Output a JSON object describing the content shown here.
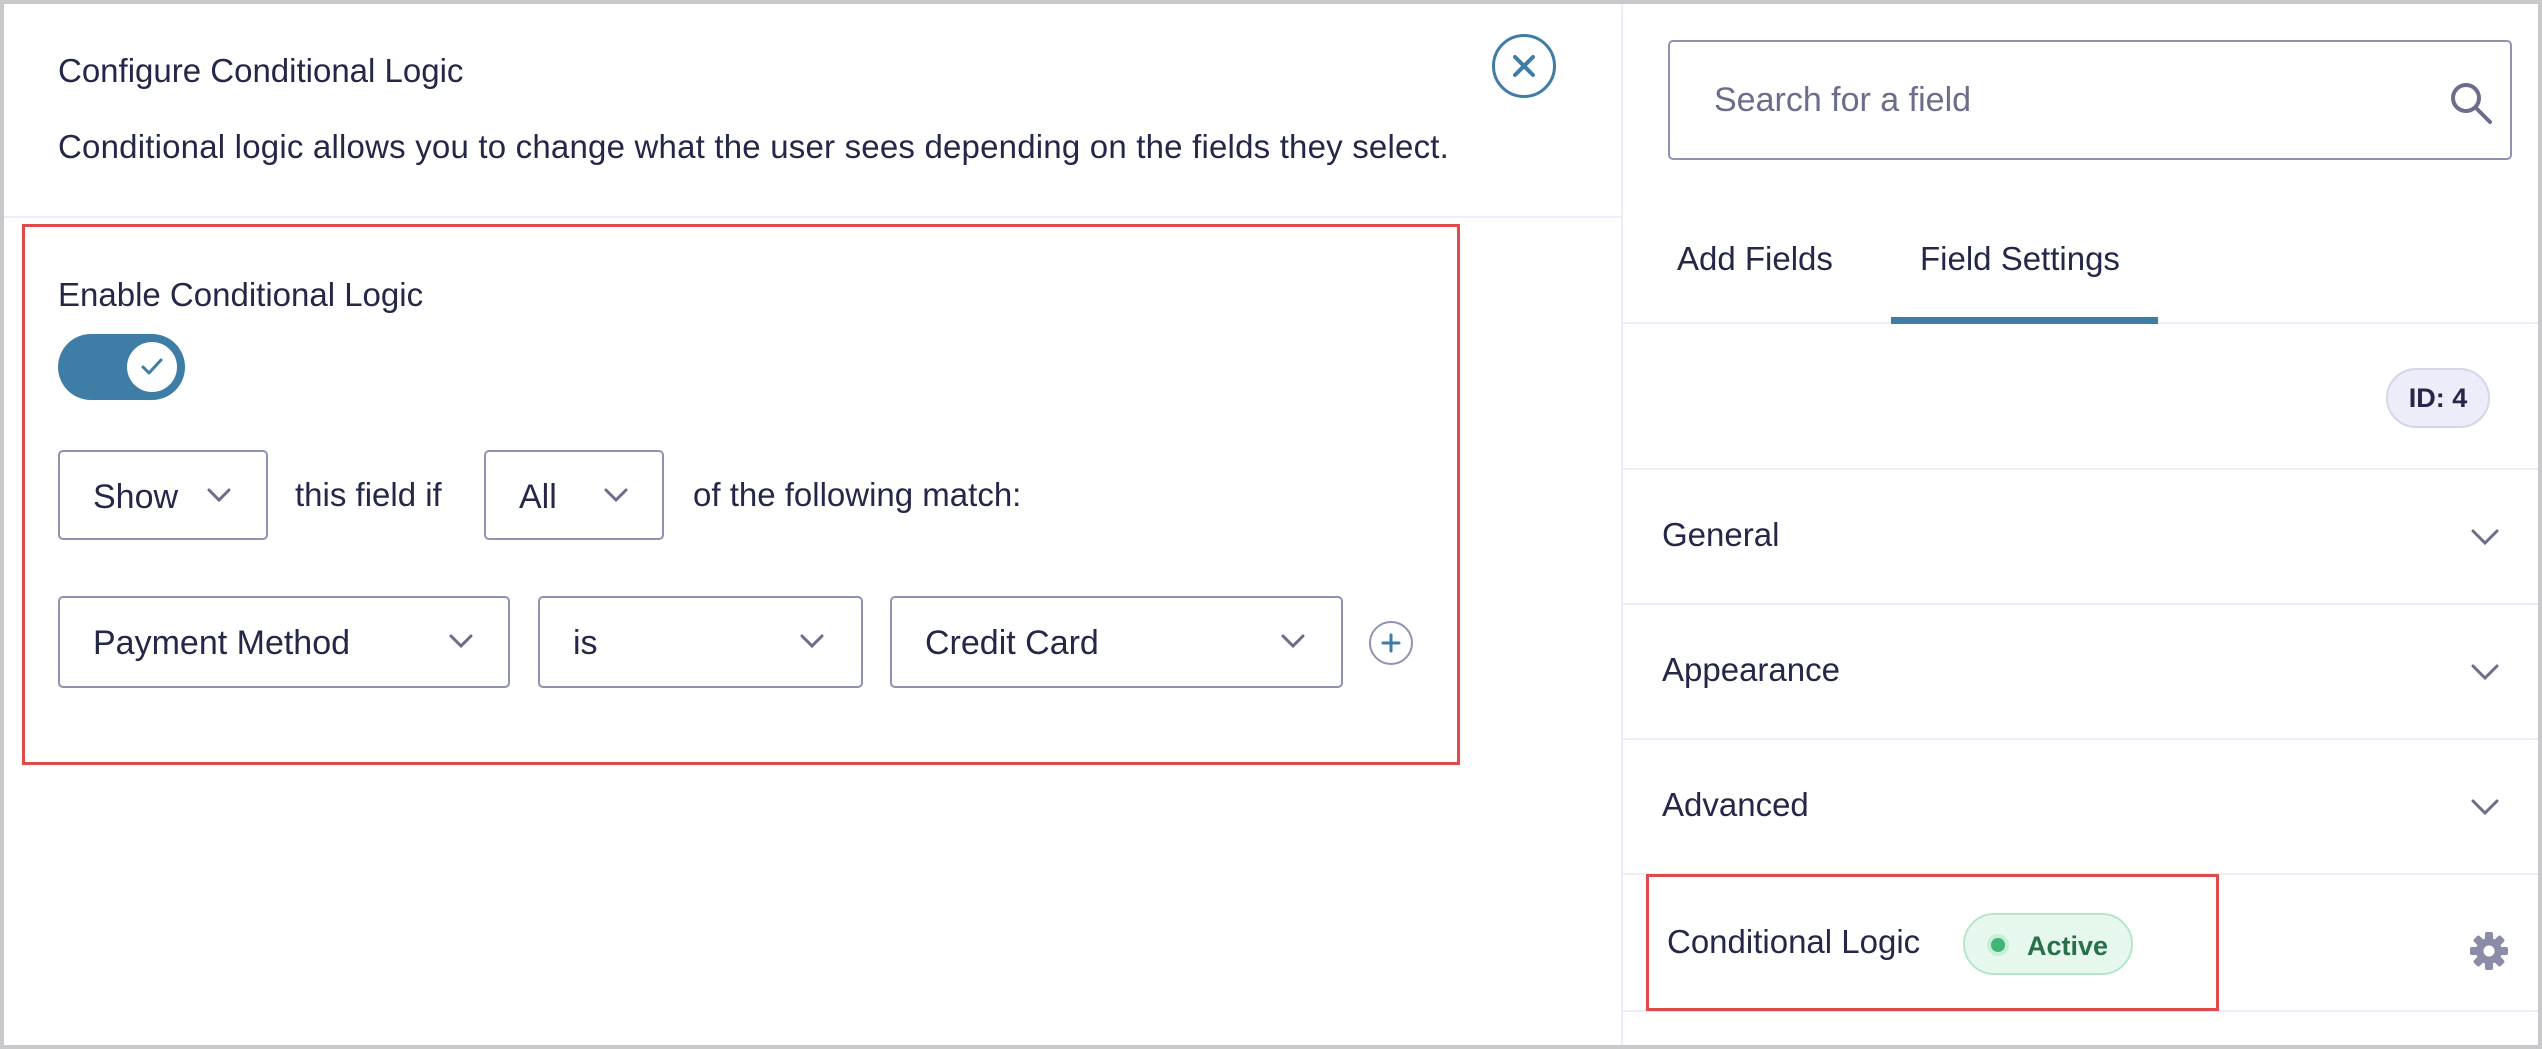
{
  "modal": {
    "title": "Configure Conditional Logic",
    "description": "Conditional logic allows you to change what the user sees depending on the fields they select.",
    "close_icon": "close-icon"
  },
  "logic": {
    "enable_label": "Enable Conditional Logic",
    "toggle_on": true,
    "action_select": {
      "value": "Show"
    },
    "text_field_if": "this field if",
    "match_select": {
      "value": "All"
    },
    "text_following": "of the following match:",
    "rule": {
      "field": "Payment Method",
      "operator": "is",
      "value": "Credit Card"
    },
    "add_rule_icon": "plus-circle-icon"
  },
  "sidebar": {
    "search": {
      "placeholder": "Search for a field",
      "value": ""
    },
    "tabs": [
      {
        "label": "Add Fields",
        "active": false
      },
      {
        "label": "Field Settings",
        "active": true
      }
    ],
    "field_id": "ID: 4",
    "sections": [
      {
        "label": "General"
      },
      {
        "label": "Appearance"
      },
      {
        "label": "Advanced"
      }
    ],
    "conditional": {
      "label": "Conditional Logic",
      "status": "Active",
      "settings_icon": "gear-icon"
    }
  },
  "colors": {
    "accent": "#3e7da6",
    "highlight": "#e14a4a",
    "text": "#242748",
    "active_badge_bg": "#e6f7ee",
    "active_text": "#27704a"
  }
}
